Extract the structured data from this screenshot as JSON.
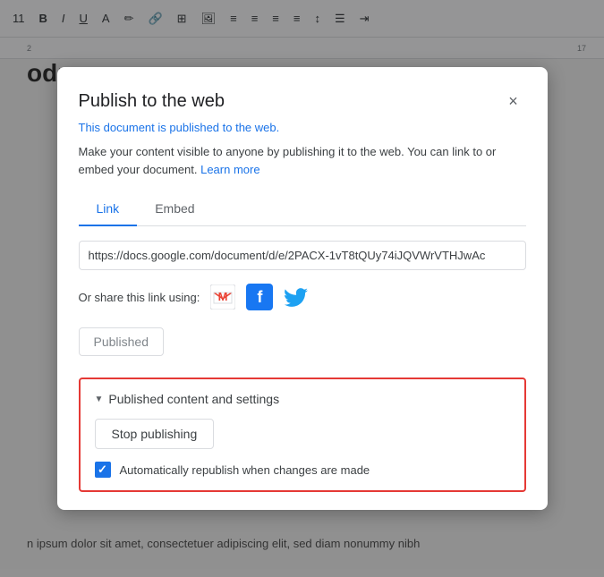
{
  "toolbar": {
    "font_size": "11",
    "items": [
      "B",
      "I",
      "U",
      "A"
    ]
  },
  "ruler": {
    "numbers": [
      "2",
      "17"
    ]
  },
  "doc": {
    "heading": "oduc",
    "body_text": "n ipsum dolor sit amet, consectetuer adipiscing elit, sed diam nonummy nibh"
  },
  "dialog": {
    "title": "Publish to the web",
    "close_label": "×",
    "notice": "This document is published to the web.",
    "description": "Make your content visible to anyone by publishing it to the web. You can link to or embed your document.",
    "learn_more": "Learn more",
    "tabs": [
      {
        "label": "Link",
        "active": true
      },
      {
        "label": "Embed",
        "active": false
      }
    ],
    "url_value": "https://docs.google.com/document/d/e/2PACX-1vT8tQUy74iJQVWrVTHJwAc",
    "url_placeholder": "",
    "share_label": "Or share this link using:",
    "share_icons": [
      {
        "name": "gmail",
        "symbol": "M"
      },
      {
        "name": "facebook",
        "symbol": "f"
      },
      {
        "name": "twitter",
        "symbol": "🐦"
      }
    ],
    "published_button_label": "Published",
    "section": {
      "header": "Published content and settings",
      "stop_button": "Stop publishing",
      "checkbox_label": "Automatically republish when changes are made",
      "checkbox_checked": true
    }
  }
}
